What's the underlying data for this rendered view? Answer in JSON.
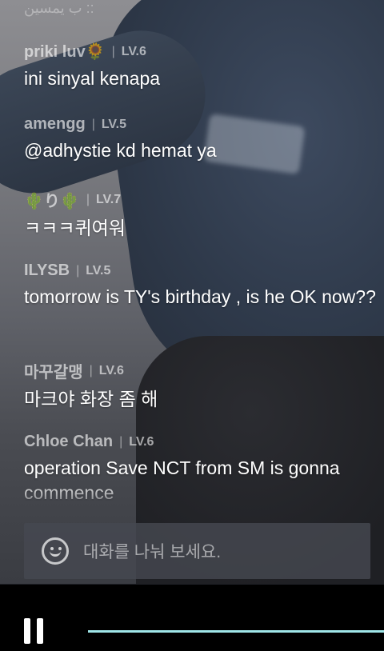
{
  "chat": {
    "top_partial": "ب يمسين ::",
    "messages": [
      {
        "user": "priki luv🌻",
        "level": "LV.6",
        "text": "ini sinyal kenapa"
      },
      {
        "user": "amengg",
        "level": "LV.5",
        "text": "@adhystie kd hemat ya"
      },
      {
        "user": "🌵り🌵",
        "level": "LV.7",
        "text": "ㅋㅋㅋ퀴여워"
      },
      {
        "user": "ILYSB",
        "level": "LV.5",
        "text": "tomorrow is TY's birthday , is he OK now??"
      },
      {
        "user": "마꾸갈맹",
        "level": "LV.6",
        "text": "마크야 화장 좀 해"
      },
      {
        "user": "Chloe Chan",
        "level": "LV.6",
        "text": "operation Save NCT from SM is gonna commence"
      }
    ]
  },
  "input": {
    "placeholder": "대화를 나눠 보세요."
  },
  "player": {
    "progress": 0,
    "accent_color": "#9fe6e8"
  }
}
